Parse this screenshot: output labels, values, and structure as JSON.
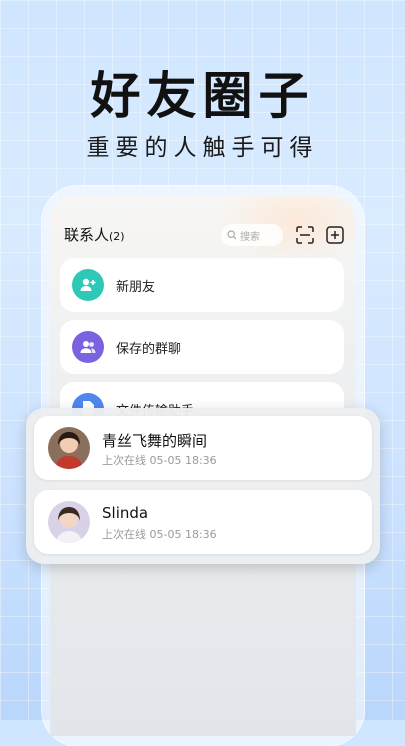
{
  "headline": "好友圈子",
  "subline": "重要的人触手可得",
  "header": {
    "title": "联系人",
    "count": "(2)",
    "search_placeholder": "搜索",
    "scan_icon": "scan-icon",
    "add_icon": "add-square-icon"
  },
  "menu": [
    {
      "label": "新朋友",
      "icon": "add-friend-icon",
      "color": "#2ec9b6"
    },
    {
      "label": "保存的群聊",
      "icon": "group-icon",
      "color": "#7a62e0"
    },
    {
      "label": "文件传输助手",
      "icon": "file-icon",
      "color": "#4f86ef"
    }
  ],
  "contacts": [
    {
      "name": "青丝飞舞的瞬间",
      "status": "上次在线 05-05 18:36"
    },
    {
      "name": "Slinda",
      "status": "上次在线 05-05 18:36"
    }
  ]
}
